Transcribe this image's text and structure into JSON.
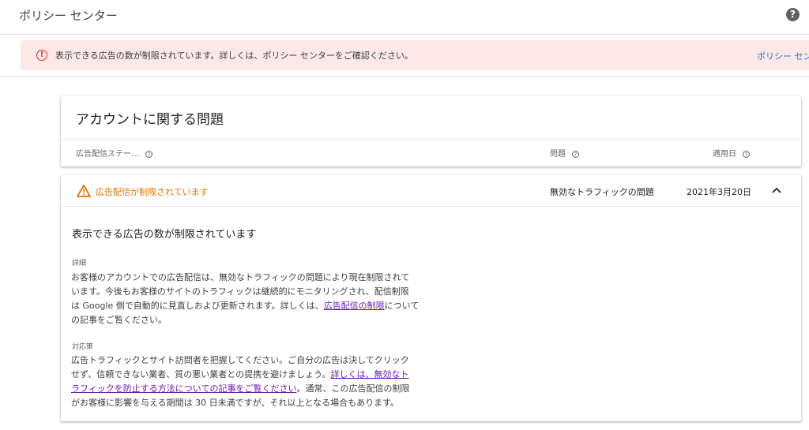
{
  "topbar": {
    "title": "ポリシー センター",
    "help_icon": "help-icon"
  },
  "alert": {
    "message": "表示できる広告の数が制限されています。詳しくは、ポリシー センターをご確認ください。",
    "link": "ポリシー セン",
    "color": "#fce8e6"
  },
  "account_issues": {
    "heading": "アカウントに関する問題",
    "columns": {
      "status": "広告配信ステー…",
      "issue": "問題",
      "date": "適用日"
    }
  },
  "row": {
    "status": "広告配信が制限されています",
    "issue": "無効なトラフィックの問題",
    "date": "2021年3月20日",
    "status_color": "#e37400"
  },
  "detail": {
    "heading": "表示できる広告の数が制限されています",
    "details_label": "詳細",
    "details_text_1": "お客様のアカウントでの広告配信は、無効なトラフィックの問題により現在制限されて",
    "details_text_2": "います。今後もお客様のサイトのトラフィックは継続的にモニタリングされ、配信制限",
    "details_text_3": "は Google 側で自動的に見直しおよび更新されます。詳しくは、",
    "details_link": "広告配信の制限",
    "details_text_4": "について",
    "details_text_5": "の記事をご覧ください。",
    "action_label": "対応策",
    "action_text_1": "広告トラフィックとサイト訪問者を把握してください。ご自分の広告は決してクリック",
    "action_text_2": "せず、信頼できない業者、質の悪い業者との提携を避けましょう。",
    "action_link_1": "詳しくは、無効なト",
    "action_link_2": "ラフィックを防止する方法についての記事をご覧ください",
    "action_text_3": "。通常、この広告配信の制限",
    "action_text_4": "がお客様に影響を与える期間は 30 日未満ですが、それ以上となる場合もあります。"
  }
}
